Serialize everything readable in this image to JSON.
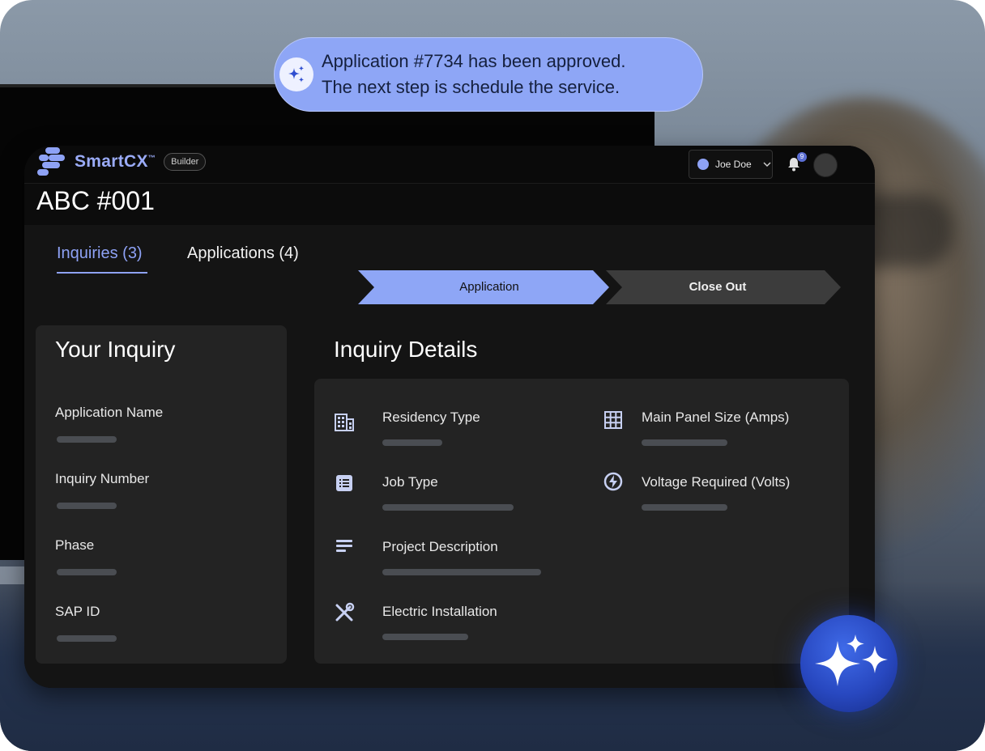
{
  "toast": {
    "line1": "Application #7734 has been approved.",
    "line2": "The next step is schedule the service.",
    "icon": "sparkle-icon"
  },
  "header": {
    "brand": "SmartCX",
    "brand_tm": "™",
    "badge": "Builder",
    "user_name": "Joe Doe",
    "notification_count": "9"
  },
  "page": {
    "title": "ABC #001"
  },
  "tabs": [
    {
      "label": "Inquiries (3)",
      "active": true
    },
    {
      "label": "Applications (4)",
      "active": false
    }
  ],
  "steps": [
    {
      "label": "Application",
      "active": true
    },
    {
      "label": "Close Out",
      "active": false
    }
  ],
  "inquiry": {
    "title": "Your Inquiry",
    "fields": [
      "Application Name",
      "Inquiry Number",
      "Phase",
      "SAP ID"
    ]
  },
  "details": {
    "title": "Inquiry Details",
    "left": [
      {
        "label": "Residency Type",
        "icon": "building-icon"
      },
      {
        "label": "Job Type",
        "icon": "list-icon"
      },
      {
        "label": "Project Description",
        "icon": "text-lines-icon"
      },
      {
        "label": "Electric Installation",
        "icon": "tools-icon"
      }
    ],
    "right": [
      {
        "label": "Main Panel Size (Amps)",
        "icon": "grid-icon"
      },
      {
        "label": "Voltage Required (Volts)",
        "icon": "lightning-icon"
      }
    ]
  },
  "colors": {
    "accent": "#8ea2f5",
    "card": "#232323",
    "bg": "#0c0c0c",
    "toast": "#8ea6f6"
  }
}
